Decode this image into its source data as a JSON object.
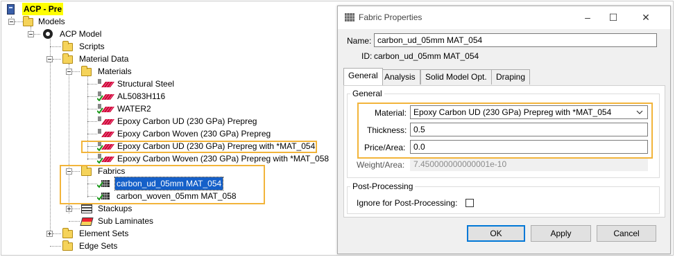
{
  "tree": {
    "root": "ACP - Pre",
    "models": "Models",
    "acp_model": "ACP Model",
    "scripts": "Scripts",
    "material_data": "Material Data",
    "materials": "Materials",
    "material_items": [
      "Structural Steel",
      "AL5083H116",
      "WATER2",
      "Epoxy Carbon UD (230 GPa) Prepreg",
      "Epoxy Carbon Woven (230 GPa) Prepreg",
      "Epoxy Carbon UD (230 GPa) Prepreg with *MAT_054",
      "Epoxy Carbon Woven (230 GPa) Prepreg with *MAT_058"
    ],
    "fabrics": "Fabrics",
    "fabric_items": [
      "carbon_ud_05mm MAT_054",
      "carbon_woven_05mm MAT_058"
    ],
    "stackups": "Stackups",
    "sub_laminates": "Sub Laminates",
    "element_sets": "Element Sets",
    "edge_sets": "Edge Sets"
  },
  "dialog": {
    "title": "Fabric Properties",
    "name_label": "Name:",
    "name_value": "carbon_ud_05mm MAT_054",
    "id_label": "ID:",
    "id_value": "carbon_ud_05mm MAT_054",
    "tabs": [
      "General",
      "Analysis",
      "Solid Model Opt.",
      "Draping"
    ],
    "general_group": "General",
    "material_label": "Material:",
    "material_value": "Epoxy Carbon UD (230 GPa) Prepreg with *MAT_054",
    "thickness_label": "Thickness:",
    "thickness_value": "0.5",
    "price_label": "Price/Area:",
    "price_value": "0.0",
    "weight_label": "Weight/Area:",
    "weight_value": "7.450000000000001e-10",
    "post_group": "Post-Processing",
    "ignore_label": "Ignore for Post-Processing:",
    "ok": "OK",
    "apply": "Apply",
    "cancel": "Cancel"
  },
  "colors": {
    "highlight": "#f2b43a",
    "selection": "#1560c9"
  },
  "icons": [
    "computer-icon",
    "folder-icon",
    "gear-icon",
    "material-icon",
    "fabric-icon",
    "stackup-icon",
    "sublaminate-icon",
    "check-icon",
    "minimize-icon",
    "maximize-icon",
    "close-icon",
    "dropdown-arrow-icon"
  ]
}
